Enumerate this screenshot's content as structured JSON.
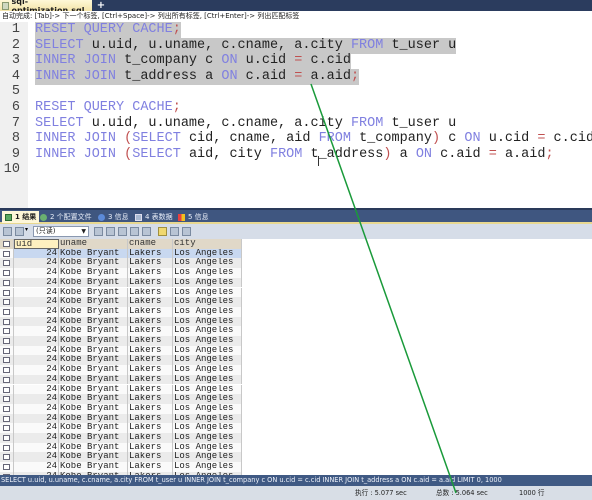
{
  "file_tab": {
    "icon": "sql-file-icon",
    "title": "sql-optimization.sql"
  },
  "add_tab": {
    "icon": "plus-icon",
    "label": "+"
  },
  "hint": "自动完成: [Tab]-> 下一个标签, [Ctrl+Space]-> 列出所有标签, [Ctrl+Enter]-> 列出匹配标签",
  "editor": {
    "lines": [
      {
        "n": "1",
        "tokens": [
          [
            "kw",
            "RESET QUERY CACHE"
          ],
          [
            "op",
            ";"
          ]
        ],
        "selected": true
      },
      {
        "n": "2",
        "tokens": [
          [
            "kw",
            "SELECT"
          ],
          [
            "t",
            " u.uid, u.uname, c.cname, a.city "
          ],
          [
            "kw",
            "FROM"
          ],
          [
            "t",
            " t_user u"
          ]
        ],
        "selected": true
      },
      {
        "n": "3",
        "tokens": [
          [
            "kw",
            "INNER JOIN"
          ],
          [
            "t",
            " t_company c "
          ],
          [
            "kw",
            "ON"
          ],
          [
            "t",
            " u.cid "
          ],
          [
            "op",
            "="
          ],
          [
            "t",
            " c.cid"
          ]
        ],
        "selected": true
      },
      {
        "n": "4",
        "tokens": [
          [
            "kw",
            "INNER JOIN"
          ],
          [
            "t",
            " t_address a "
          ],
          [
            "kw",
            "ON"
          ],
          [
            "t",
            " c.aid "
          ],
          [
            "op",
            "="
          ],
          [
            "t",
            " a.aid"
          ],
          [
            "op",
            ";"
          ]
        ],
        "selected": true
      },
      {
        "n": "5",
        "tokens": [],
        "selected": false
      },
      {
        "n": "6",
        "tokens": [
          [
            "kw",
            "RESET QUERY CACHE"
          ],
          [
            "op",
            ";"
          ]
        ],
        "selected": false
      },
      {
        "n": "7",
        "tokens": [
          [
            "kw",
            "SELECT"
          ],
          [
            "t",
            " u.uid, u.uname, c.cname, a.city "
          ],
          [
            "kw",
            "FROM"
          ],
          [
            "t",
            " t_user u"
          ]
        ],
        "selected": false
      },
      {
        "n": "8",
        "tokens": [
          [
            "kw",
            "INNER JOIN"
          ],
          [
            "t",
            " "
          ],
          [
            "op",
            "("
          ],
          [
            "kw",
            "SELECT"
          ],
          [
            "t",
            " cid, cname, aid "
          ],
          [
            "kw",
            "FROM"
          ],
          [
            "t",
            " t_company"
          ],
          [
            "op",
            ")"
          ],
          [
            "t",
            " c "
          ],
          [
            "kw",
            "ON"
          ],
          [
            "t",
            " u.cid "
          ],
          [
            "op",
            "="
          ],
          [
            "t",
            " c.cid"
          ]
        ],
        "selected": false
      },
      {
        "n": "9",
        "tokens": [
          [
            "kw",
            "INNER JOIN"
          ],
          [
            "t",
            " "
          ],
          [
            "op",
            "("
          ],
          [
            "kw",
            "SELECT"
          ],
          [
            "t",
            " aid, city "
          ],
          [
            "kw",
            "FROM"
          ],
          [
            "t",
            " t_address"
          ],
          [
            "op",
            ")"
          ],
          [
            "t",
            " a "
          ],
          [
            "kw",
            "ON"
          ],
          [
            "t",
            " c.aid "
          ],
          [
            "op",
            "="
          ],
          [
            "t",
            " a.aid"
          ],
          [
            "op",
            ";"
          ]
        ],
        "selected": false
      },
      {
        "n": "10",
        "tokens": [],
        "selected": false
      }
    ]
  },
  "result_tabs": [
    {
      "label": "1 结果",
      "icon": "table-result-icon",
      "active": true
    },
    {
      "label": "2 个配置文件",
      "icon": "profile-icon",
      "active": false
    },
    {
      "label": "3 信息",
      "icon": "info-icon",
      "active": false
    },
    {
      "label": "4 表数据",
      "icon": "table-data-icon",
      "active": false
    },
    {
      "label": "5 信息",
      "icon": "info-color-icon",
      "active": false
    }
  ],
  "toolbar": {
    "mode_select": "(只读)",
    "icons": [
      "grid-view-icon",
      "export-icon",
      "insert-row-icon",
      "duplicate-row-icon",
      "save-icon",
      "delete-icon",
      "cancel-icon",
      "grid-mode-icon",
      "form-mode-icon",
      "text-mode-icon"
    ]
  },
  "grid": {
    "columns": [
      "uid",
      "uname",
      "cname",
      "city"
    ],
    "rows": [
      [
        "24",
        "Kobe Bryant",
        "Lakers",
        "Los Angeles"
      ],
      [
        "24",
        "Kobe Bryant",
        "Lakers",
        "Los Angeles"
      ],
      [
        "24",
        "Kobe Bryant",
        "Lakers",
        "Los Angeles"
      ],
      [
        "24",
        "Kobe Bryant",
        "Lakers",
        "Los Angeles"
      ],
      [
        "24",
        "Kobe Bryant",
        "Lakers",
        "Los Angeles"
      ],
      [
        "24",
        "Kobe Bryant",
        "Lakers",
        "Los Angeles"
      ],
      [
        "24",
        "Kobe Bryant",
        "Lakers",
        "Los Angeles"
      ],
      [
        "24",
        "Kobe Bryant",
        "Lakers",
        "Los Angeles"
      ],
      [
        "24",
        "Kobe Bryant",
        "Lakers",
        "Los Angeles"
      ],
      [
        "24",
        "Kobe Bryant",
        "Lakers",
        "Los Angeles"
      ],
      [
        "24",
        "Kobe Bryant",
        "Lakers",
        "Los Angeles"
      ],
      [
        "24",
        "Kobe Bryant",
        "Lakers",
        "Los Angeles"
      ],
      [
        "24",
        "Kobe Bryant",
        "Lakers",
        "Los Angeles"
      ],
      [
        "24",
        "Kobe Bryant",
        "Lakers",
        "Los Angeles"
      ],
      [
        "24",
        "Kobe Bryant",
        "Lakers",
        "Los Angeles"
      ],
      [
        "24",
        "Kobe Bryant",
        "Lakers",
        "Los Angeles"
      ],
      [
        "24",
        "Kobe Bryant",
        "Lakers",
        "Los Angeles"
      ],
      [
        "24",
        "Kobe Bryant",
        "Lakers",
        "Los Angeles"
      ],
      [
        "24",
        "Kobe Bryant",
        "Lakers",
        "Los Angeles"
      ],
      [
        "24",
        "Kobe Bryant",
        "Lakers",
        "Los Angeles"
      ],
      [
        "24",
        "Kobe Bryant",
        "Lakers",
        "Los Angeles"
      ],
      [
        "24",
        "Kobe Bryant",
        "Lakers",
        "Los Angeles"
      ],
      [
        "24",
        "Kobe Bryant",
        "Lakers",
        "Los Angeles"
      ],
      [
        "24",
        "Kobe Bryant",
        "Lakers",
        "Los Angeles"
      ]
    ]
  },
  "status": {
    "sql": "SELECT u.uid, u.uname, c.cname, a.city FROM t_user u INNER JOIN t_company c ON u.cid = c.cid INNER JOIN t_address a ON c.aid = a.aid LIMIT 0, 1000",
    "exec_time": "执行 : 5.077 sec",
    "total_time": "总数 : 5.064 sec",
    "rows": "1000 行"
  },
  "colors": {
    "keyword": "#8080e0",
    "operator": "#c05050",
    "selection": "#c8c8c8",
    "panel_blue": "#3f5680",
    "annotation_line": "#1a9a3a"
  }
}
